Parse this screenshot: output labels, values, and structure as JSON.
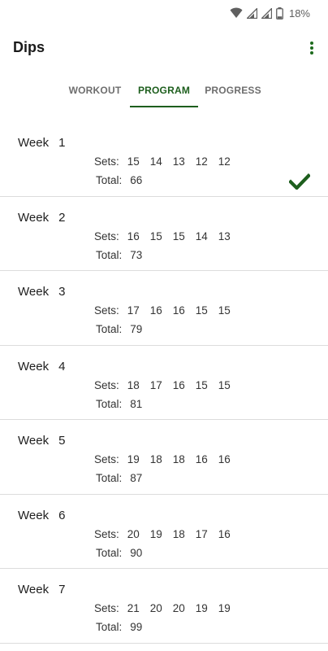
{
  "status_bar": {
    "battery_percent": "18%",
    "icons": [
      "wifi-icon",
      "signal-icon",
      "signal-icon-2",
      "battery-icon"
    ]
  },
  "app_bar": {
    "title": "Dips",
    "menu_icon": "more-vertical-icon"
  },
  "tabs": [
    {
      "label": "WORKOUT",
      "active": false
    },
    {
      "label": "PROGRAM",
      "active": true
    },
    {
      "label": "PROGRESS",
      "active": false
    }
  ],
  "colors": {
    "accent": "#1d5e1d",
    "divider": "#dcdcdc"
  },
  "program": {
    "weeks": [
      {
        "label": "Week",
        "number": "1",
        "sets_label": "Sets:",
        "sets": [
          "15",
          "14",
          "13",
          "12",
          "12"
        ],
        "total_label": "Total:",
        "total": "66",
        "completed": true
      },
      {
        "label": "Week",
        "number": "2",
        "sets_label": "Sets:",
        "sets": [
          "16",
          "15",
          "15",
          "14",
          "13"
        ],
        "total_label": "Total:",
        "total": "73",
        "completed": false
      },
      {
        "label": "Week",
        "number": "3",
        "sets_label": "Sets:",
        "sets": [
          "17",
          "16",
          "16",
          "15",
          "15"
        ],
        "total_label": "Total:",
        "total": "79",
        "completed": false
      },
      {
        "label": "Week",
        "number": "4",
        "sets_label": "Sets:",
        "sets": [
          "18",
          "17",
          "16",
          "15",
          "15"
        ],
        "total_label": "Total:",
        "total": "81",
        "completed": false
      },
      {
        "label": "Week",
        "number": "5",
        "sets_label": "Sets:",
        "sets": [
          "19",
          "18",
          "18",
          "16",
          "16"
        ],
        "total_label": "Total:",
        "total": "87",
        "completed": false
      },
      {
        "label": "Week",
        "number": "6",
        "sets_label": "Sets:",
        "sets": [
          "20",
          "19",
          "18",
          "17",
          "16"
        ],
        "total_label": "Total:",
        "total": "90",
        "completed": false
      },
      {
        "label": "Week",
        "number": "7",
        "sets_label": "Sets:",
        "sets": [
          "21",
          "20",
          "20",
          "19",
          "19"
        ],
        "total_label": "Total:",
        "total": "99",
        "completed": false
      }
    ]
  }
}
